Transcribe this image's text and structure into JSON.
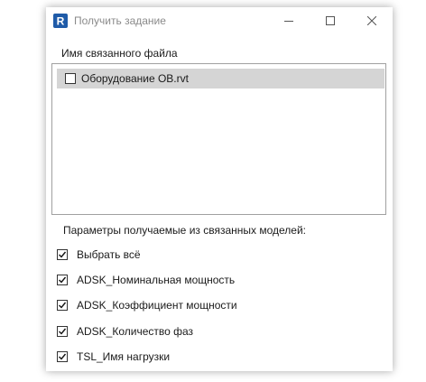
{
  "window": {
    "title": "Получить задание",
    "app_icon": "revit-logo-icon",
    "accent_color": "#1f5ba8",
    "selection_color": "#d5d5d5",
    "controls": {
      "minimize": "minimize-icon",
      "maximize": "maximize-icon",
      "close": "close-icon"
    }
  },
  "linked_files": {
    "label": "Имя связанного файла",
    "items": [
      {
        "label": "Оборудование ОВ.rvt",
        "checked": false,
        "selected": true
      }
    ]
  },
  "parameters": {
    "label": "Параметры получаемые из связанных моделей:",
    "items": [
      {
        "label": "Выбрать всё",
        "checked": true
      },
      {
        "label": "ADSK_Номинальная мощность",
        "checked": true
      },
      {
        "label": "ADSK_Коэффициент мощности",
        "checked": true
      },
      {
        "label": "ADSK_Количество фаз",
        "checked": true
      },
      {
        "label": "TSL_Имя нагрузки",
        "checked": true
      }
    ]
  }
}
